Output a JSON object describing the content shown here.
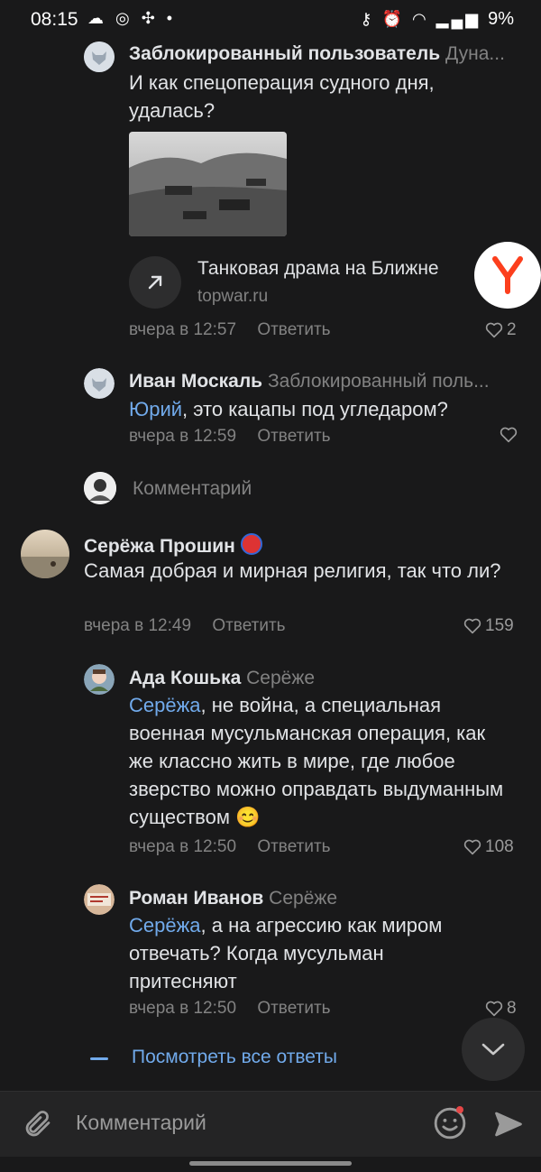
{
  "status_bar": {
    "time": "08:15",
    "battery": "9%"
  },
  "comments": [
    {
      "author": "Заблокированный пользователь",
      "reply_to": "Дуна...",
      "text": "И как спецоперация судного дня, удалась?",
      "link_title": "Танковая драма на Ближне",
      "link_domain": "topwar.ru",
      "time": "вчера в 12:57",
      "reply_label": "Ответить",
      "likes": "2"
    },
    {
      "author": "Иван Москаль",
      "reply_to": "Заблокированный поль...",
      "mention": "Юрий",
      "text": ", это кацапы под угледаром?",
      "time": "вчера в 12:59",
      "reply_label": "Ответить",
      "likes": ""
    },
    {
      "author": "Серёжа Прошин",
      "text": "Самая добрая и мирная религия, так что ли?",
      "time": "вчера в 12:49",
      "reply_label": "Ответить",
      "likes": "159"
    },
    {
      "author": "Ада Кошька",
      "reply_to": "Серёже",
      "mention": "Серёжа",
      "text": ", не война, а специальная военная мусульманская операция, как же классно жить в мире, где любое зверство можно оправдать выдуманным существом 😊",
      "time": "вчера в 12:50",
      "reply_label": "Ответить",
      "likes": "108"
    },
    {
      "author": "Роман Иванов",
      "reply_to": "Серёже",
      "mention": "Серёжа",
      "text": ", а на агрессию как миром отвечать? Когда мусульман притесняют",
      "time": "вчера в 12:50",
      "reply_label": "Ответить",
      "likes": "8"
    }
  ],
  "comment_prompt": "Комментарий",
  "show_all_replies": "Посмотреть все ответы",
  "bottom_bar": {
    "placeholder": "Комментарий"
  },
  "colors": {
    "background": "#19191a",
    "link": "#71aaeb",
    "muted": "#828282",
    "yandex_red": "#fc3f1d"
  }
}
